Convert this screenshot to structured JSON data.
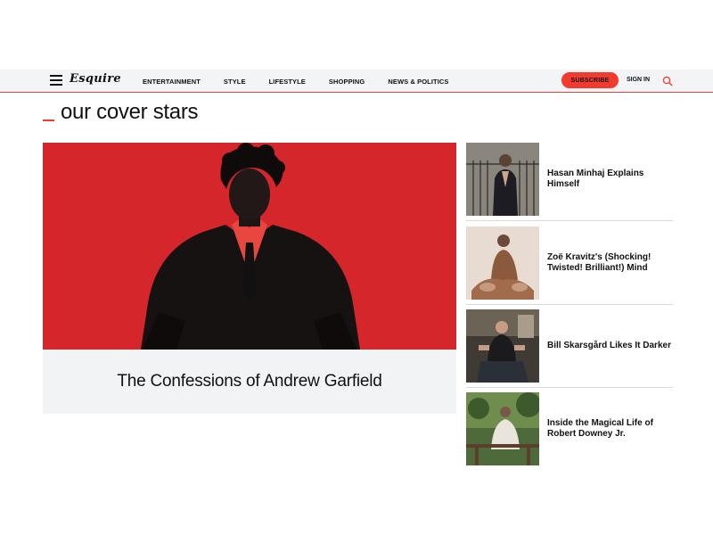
{
  "header": {
    "logo": "Esquire",
    "nav": [
      "ENTERTAINMENT",
      "STYLE",
      "LIFESTYLE",
      "SHOPPING",
      "NEWS & POLITICS"
    ],
    "subscribe_label": "SUBSCRIBE",
    "signin_label": "SIGN IN"
  },
  "section": {
    "title": "our cover stars"
  },
  "feature": {
    "headline": "The Confessions of Andrew Garfield"
  },
  "stories": [
    {
      "title": "Hasan Minhaj Explains Himself"
    },
    {
      "title": "Zoë Kravitz's (Shocking! Twisted! Brilliant!) Mind"
    },
    {
      "title": "Bill Skarsgård Likes It Darker"
    },
    {
      "title": "Inside the Magical Life of Robert Downey Jr."
    }
  ],
  "colors": {
    "accent": "#f23a2e",
    "feature_bg": "#d5262c",
    "caption_bg": "#f2f3f5",
    "header_bg": "#f3f4f6"
  }
}
